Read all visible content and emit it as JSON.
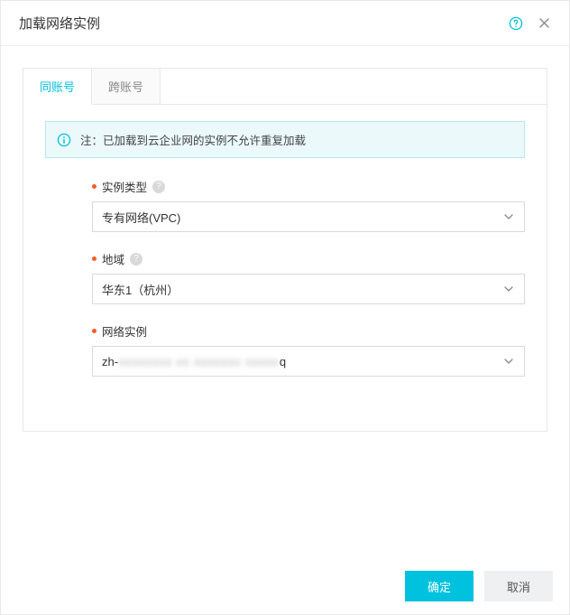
{
  "header": {
    "title": "加载网络实例"
  },
  "tabs": {
    "same_account": "同账号",
    "cross_account": "跨账号"
  },
  "banner": {
    "text": "注：已加载到云企业网的实例不允许重复加载"
  },
  "form": {
    "instance_type": {
      "label": "实例类型",
      "value": "专有网络(VPC)"
    },
    "region": {
      "label": "地域",
      "value": "华东1（杭州）"
    },
    "network_instance": {
      "label": "网络实例",
      "prefix": "zh-",
      "masked": "xxxxxxxx xx xxxxxxx xxxxx",
      "suffix": "q"
    }
  },
  "footer": {
    "ok": "确定",
    "cancel": "取消"
  },
  "colors": {
    "accent": "#00c1de",
    "required": "#ff5b22",
    "bannerBg": "#ebf9fb",
    "bannerBorder": "#b6e7ef"
  }
}
